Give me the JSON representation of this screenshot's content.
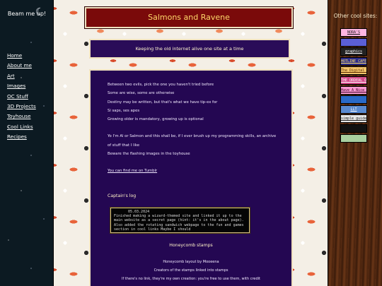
{
  "sidebar": {
    "title": "Beam me up!",
    "moon_icon": "crescent-moon-icon",
    "nav": [
      {
        "label": "Home"
      },
      {
        "label": "About me"
      },
      {
        "label": "Art"
      },
      {
        "label": "Images"
      },
      {
        "label": "OC Stuff"
      },
      {
        "label": "3D Projects"
      },
      {
        "label": "Toyhouse"
      },
      {
        "label": "Cool Links"
      },
      {
        "label": "Recipes"
      }
    ]
  },
  "header": {
    "title": "Salmons and Ravene",
    "subtitle": "Keeping the old internet alive one site at a time"
  },
  "intro": {
    "lines_a": [
      "Between two evils, pick the one you haven't tried before",
      "Some are wise, some are otherwise",
      "Destiny may be written, but that's what we have tip-ex for",
      "Si saps, ses apes",
      "Growing older is mandatory, growing up is optional"
    ],
    "lines_b": [
      "Yo I'm Al or Salmon and this shall be, if I ever brush up my programming skills, an archive of stuff that I like",
      "Beware the flashing images in the toyhouse"
    ],
    "tumblr_text": "You can find me on Tumblr"
  },
  "log": {
    "heading": "Captain's log",
    "date": "05.03.2024",
    "text": "Finished making a wizard-themed site and linked it up to the main website as a secret page (hint: it's in the about page). Also added the rotating sandwich webpage to the fun and games section in cool links Maybe I should"
  },
  "stamps": {
    "heading": "Honeycomb stamps",
    "lines": [
      "Honeycomb layout by Mooeena",
      "Creators of the stamps linked into stamps",
      "If there's no link, they're my own creation: you're free to use them, with credit"
    ]
  },
  "rightbar": {
    "title": "Other cool sites:",
    "badges": [
      {
        "label": "NORA'S",
        "bg": "#ffb6e2",
        "fg": "#111111"
      },
      {
        "label": "",
        "bg": "#5b5fd6",
        "fg": "#ffffff"
      },
      {
        "label": "graphics",
        "bg": "#222222",
        "fg": "#ffffff"
      },
      {
        "label": "HOTLINE CAFE",
        "bg": "#2c2c8a",
        "fg": "#ffe36b"
      },
      {
        "label": "The Digital Island",
        "bg": "#f2c46a",
        "fg": "#5a2a00"
      },
      {
        "label": "THE ORDEAL OF FINALLY DYING",
        "bg": "#d44a8a",
        "fg": "#ffffff"
      },
      {
        "label": "Have A Nice Day",
        "bg": "#ff9ad2",
        "fg": "#330022"
      },
      {
        "label": "",
        "bg": "#2a6ac8",
        "fg": "#ffffff"
      },
      {
        "label": "LLT",
        "bg": "#5a8ad0",
        "fg": "#ffffff"
      },
      {
        "label": "simple guide",
        "bg": "#e8e8e8",
        "fg": "#222222"
      },
      {
        "label": "",
        "bg": "#111111",
        "fg": "#ffffff"
      },
      {
        "label": "",
        "bg": "#a8d0a0",
        "fg": "#1a3a1a"
      }
    ]
  },
  "colors": {
    "header_bg": "#7a0a0a",
    "header_text": "#ffd86a",
    "content_bg": "#240752",
    "sidebar_bg": "#0c1a22"
  }
}
